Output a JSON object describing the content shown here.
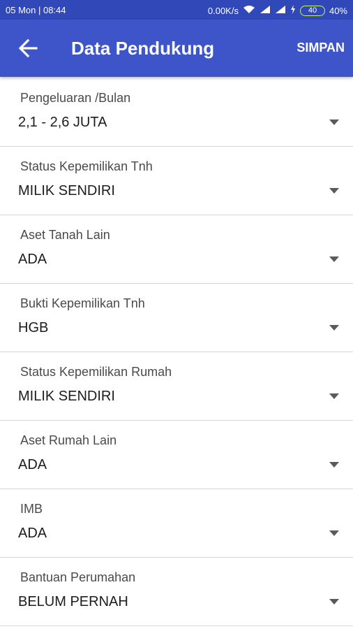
{
  "status_bar": {
    "left_text": "05 Mon | 08:44",
    "speed": "0.00K/s",
    "battery_level": "40",
    "battery_percent": "40%",
    "icons": [
      "wifi-icon",
      "signal-icon",
      "signal-icon",
      "charging-icon"
    ]
  },
  "app_bar": {
    "title": "Data Pendukung",
    "save_label": "SIMPAN",
    "back_icon": "arrow-left-icon",
    "background_color": "#3e55c9"
  },
  "fields": [
    {
      "label": "Pengeluaran /Bulan",
      "value": "2,1 - 2,6 JUTA"
    },
    {
      "label": "Status Kepemilikan Tnh",
      "value": "MILIK SENDIRI"
    },
    {
      "label": "Aset Tanah Lain",
      "value": "ADA"
    },
    {
      "label": "Bukti Kepemilikan Tnh",
      "value": "HGB"
    },
    {
      "label": "Status Kepemilikan Rumah",
      "value": "MILIK SENDIRI"
    },
    {
      "label": "Aset Rumah Lain",
      "value": "ADA"
    },
    {
      "label": "IMB",
      "value": "ADA"
    },
    {
      "label": "Bantuan Perumahan",
      "value": "BELUM PERNAH"
    }
  ]
}
